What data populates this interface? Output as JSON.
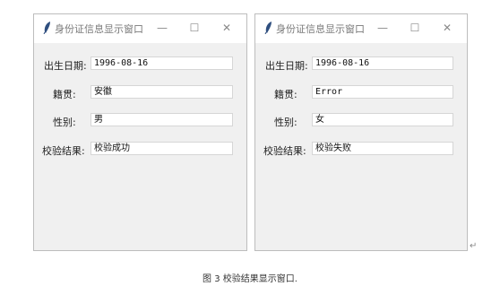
{
  "windows": [
    {
      "title": "身份证信息显示窗口",
      "min_glyph": "—",
      "max_glyph": "☐",
      "close_glyph": "✕",
      "fields": [
        {
          "label": "出生日期:",
          "value": "1996-08-16"
        },
        {
          "label": "籍贯:",
          "value": "安徽"
        },
        {
          "label": "性别:",
          "value": "男"
        },
        {
          "label": "校验结果:",
          "value": "校验成功"
        }
      ]
    },
    {
      "title": "身份证信息显示窗口",
      "min_glyph": "—",
      "max_glyph": "☐",
      "close_glyph": "✕",
      "fields": [
        {
          "label": "出生日期:",
          "value": "1996-08-16"
        },
        {
          "label": "籍贯:",
          "value": "Error"
        },
        {
          "label": "性别:",
          "value": "女"
        },
        {
          "label": "校验结果:",
          "value": "校验失败"
        }
      ]
    }
  ],
  "caption": "图 3  校验结果显示窗口.",
  "paragraph_mark": "↵",
  "icon_names": [
    "feather-icon",
    "minimize-icon",
    "maximize-icon",
    "close-icon"
  ]
}
